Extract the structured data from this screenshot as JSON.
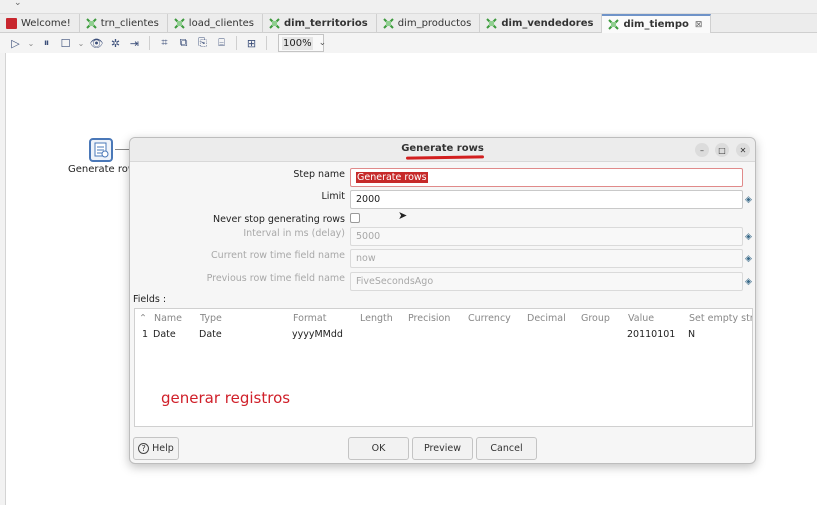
{
  "tabs": [
    {
      "label": "Welcome!",
      "icon": "welcome-icon",
      "bold": false
    },
    {
      "label": "trn_clientes",
      "icon": "transformation-icon",
      "bold": false
    },
    {
      "label": "load_clientes",
      "icon": "transformation-icon",
      "bold": false
    },
    {
      "label": "dim_territorios",
      "icon": "transformation-icon",
      "bold": true
    },
    {
      "label": "dim_productos",
      "icon": "transformation-icon",
      "bold": false
    },
    {
      "label": "dim_vendedores",
      "icon": "transformation-icon",
      "bold": true
    },
    {
      "label": "dim_tiempo",
      "icon": "transformation-icon",
      "bold": true,
      "close": "⊠"
    }
  ],
  "toolbar": {
    "zoom": "100%"
  },
  "canvas": {
    "step_label": "Generate rows"
  },
  "dialog": {
    "title": "Generate rows",
    "step_name_label": "Step name",
    "step_name_value": "Generate rows",
    "limit_label": "Limit",
    "limit_value": "2000",
    "never_stop_label": "Never stop generating rows",
    "interval_label": "Interval in ms (delay)",
    "interval_value": "5000",
    "current_time_label": "Current row time field name",
    "current_time_value": "now",
    "previous_time_label": "Previous row time field name",
    "previous_time_value": "FiveSecondsAgo",
    "fields_label": "Fields :",
    "table_headers": [
      "Name",
      "Type",
      "Format",
      "Length",
      "Precision",
      "Currency",
      "Decimal",
      "Group",
      "Value",
      "Set empty str"
    ],
    "rows": [
      {
        "num": "1",
        "name": "Date",
        "type": "Date",
        "format": "yyyyMMdd",
        "length": "",
        "precision": "",
        "currency": "",
        "decimal": "",
        "group": "",
        "value": "20110101",
        "set_empty": "N"
      }
    ],
    "annotation": "generar registros",
    "help_label": "Help",
    "ok_label": "OK",
    "preview_label": "Preview",
    "cancel_label": "Cancel"
  },
  "colors": {
    "annotation": "#d0202a",
    "accent": "#4a78b8"
  }
}
